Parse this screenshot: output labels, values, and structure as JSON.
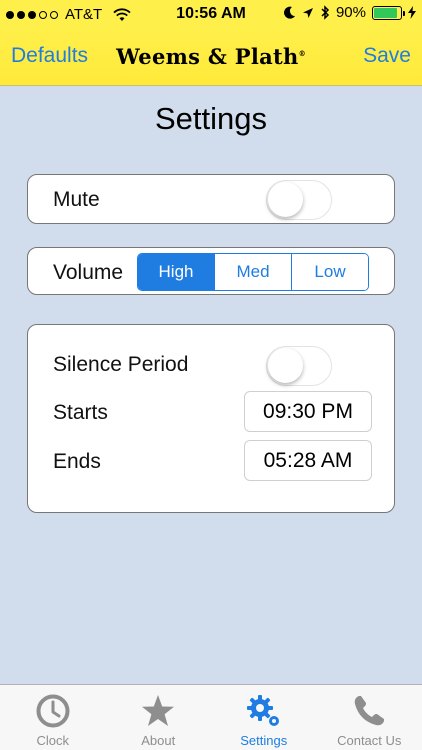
{
  "status_bar": {
    "carrier": "AT&T",
    "time": "10:56 AM",
    "battery_percent": "90%",
    "signal_bars_filled": 3,
    "signal_bars_total": 5,
    "battery_level": 0.9,
    "battery_color": "#32c759"
  },
  "nav": {
    "left_button": "Defaults",
    "brand": "Weems & Plath",
    "brand_mark": "®",
    "right_button": "Save"
  },
  "page": {
    "title": "Settings"
  },
  "mute": {
    "label": "Mute",
    "on": false
  },
  "volume": {
    "label": "Volume",
    "options": [
      "High",
      "Med",
      "Low"
    ],
    "selected": "High"
  },
  "silence": {
    "label": "Silence Period",
    "on": false,
    "starts_label": "Starts",
    "starts_value": "09:30 PM",
    "ends_label": "Ends",
    "ends_value": "05:28 AM"
  },
  "tabs": [
    {
      "label": "Clock",
      "icon": "clock-icon",
      "active": false
    },
    {
      "label": "About",
      "icon": "star-icon",
      "active": false
    },
    {
      "label": "Settings",
      "icon": "gear-icon",
      "active": true
    },
    {
      "label": "Contact Us",
      "icon": "phone-icon",
      "active": false
    }
  ],
  "colors": {
    "accent": "#1f7de2",
    "header_yellow": "#ffef4a",
    "content_bg": "#d1dcec",
    "tab_inactive": "#8e8e8e"
  }
}
